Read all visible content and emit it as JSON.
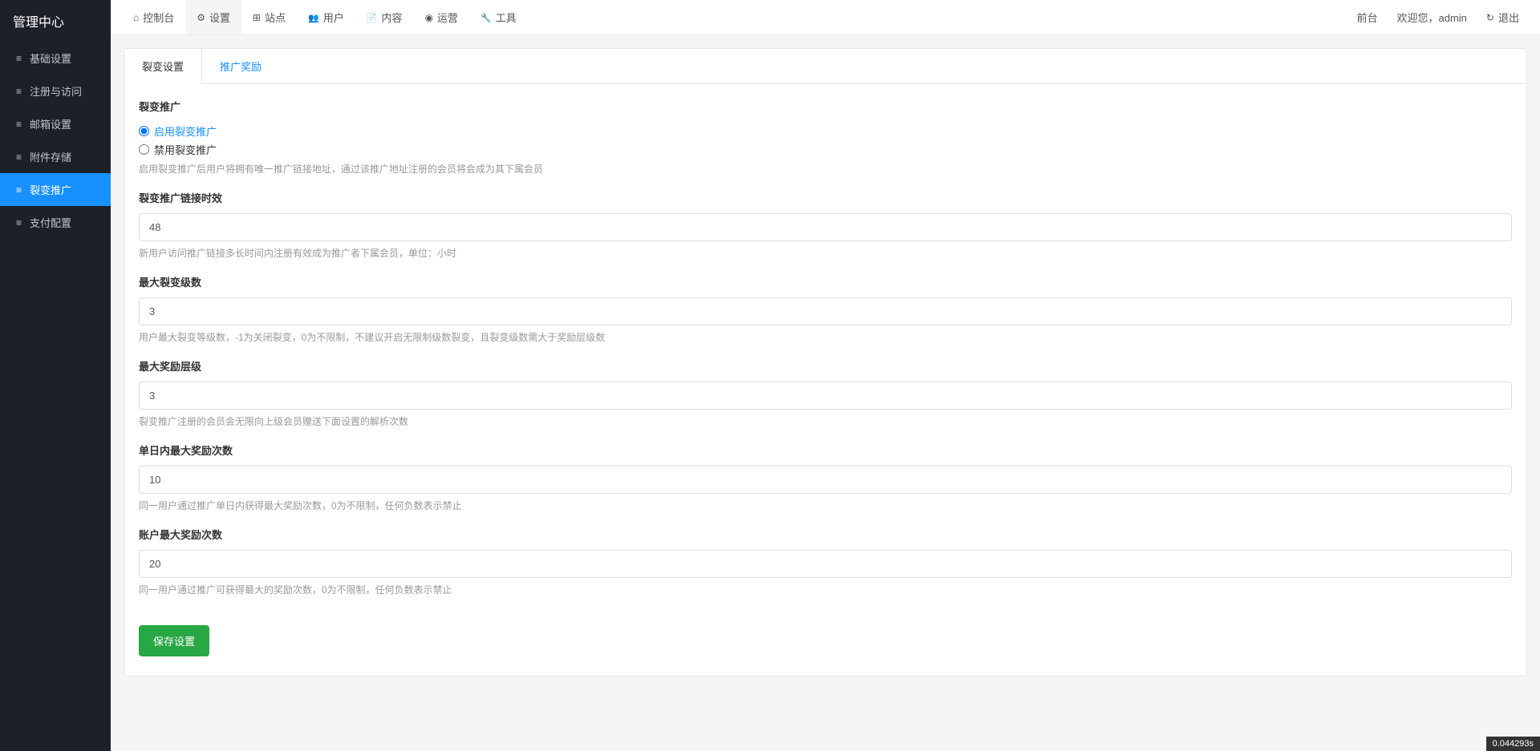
{
  "sidebar": {
    "title": "管理中心",
    "items": [
      {
        "label": "基础设置"
      },
      {
        "label": "注册与访问"
      },
      {
        "label": "邮箱设置"
      },
      {
        "label": "附件存储"
      },
      {
        "label": "裂变推广"
      },
      {
        "label": "支付配置"
      }
    ]
  },
  "topnav": {
    "left": [
      {
        "label": "控制台"
      },
      {
        "label": "设置"
      },
      {
        "label": "站点"
      },
      {
        "label": "用户"
      },
      {
        "label": "内容"
      },
      {
        "label": "运营"
      },
      {
        "label": "工具"
      }
    ],
    "right_frontend": "前台",
    "right_welcome": "欢迎您，admin",
    "right_logout": "退出"
  },
  "tabs": {
    "settings": "裂变设置",
    "rewards": "推广奖励"
  },
  "form": {
    "section_title": "裂变推广",
    "radio_enable": "启用裂变推广",
    "radio_disable": "禁用裂变推广",
    "radio_help": "启用裂变推广后用户将拥有唯一推广链接地址，通过该推广地址注册的会员将会成为其下属会员",
    "f1_label": "裂变推广链接时效",
    "f1_value": "48",
    "f1_help": "新用户访问推广链接多长时间内注册有效成为推广者下属会员，单位：小时",
    "f2_label": "最大裂变级数",
    "f2_value": "3",
    "f2_help": "用户最大裂变等级数，-1为关闭裂变，0为不限制，不建议开启无限制级数裂变，且裂变级数需大于奖励层级数",
    "f3_label": "最大奖励层级",
    "f3_value": "3",
    "f3_help": "裂变推广注册的会员会无限向上级会员赠送下面设置的解析次数",
    "f4_label": "单日内最大奖励次数",
    "f4_value": "10",
    "f4_help": "同一用户通过推广单日内获得最大奖励次数，0为不限制，任何负数表示禁止",
    "f5_label": "账户最大奖励次数",
    "f5_value": "20",
    "f5_help": "同一用户通过推广可获得最大的奖励次数，0为不限制，任何负数表示禁止",
    "save_btn": "保存设置"
  },
  "timer": "0.044293s"
}
